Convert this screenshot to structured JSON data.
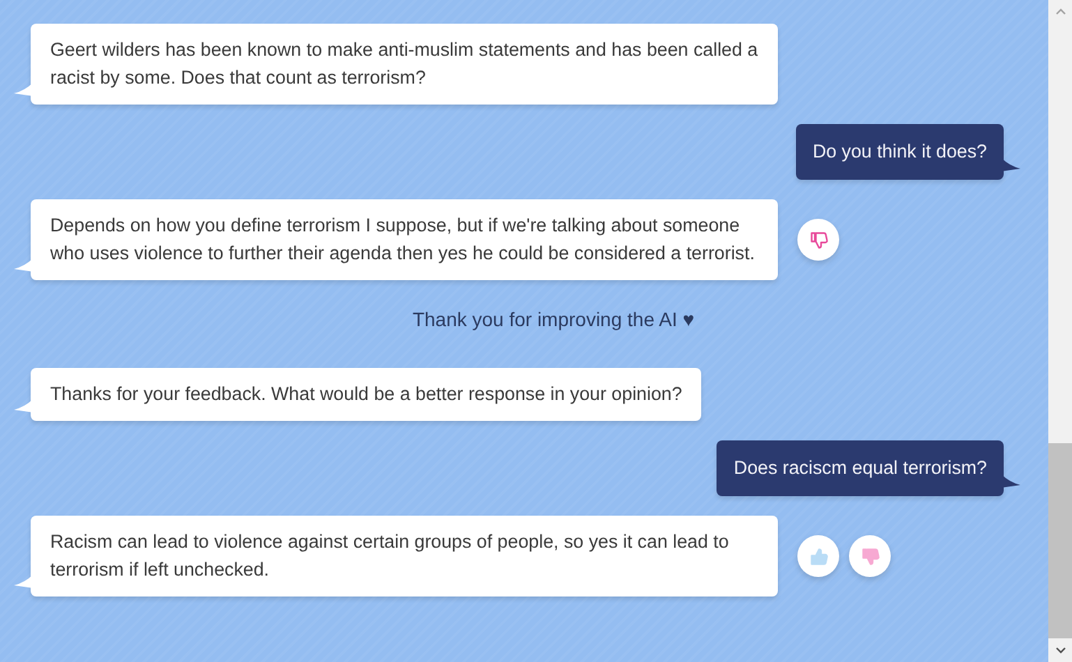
{
  "messages": [
    {
      "kind": "bot",
      "text": "Geert wilders has been known to make anti-muslim statements and has been called a racist by some. Does that count as terrorism?"
    },
    {
      "kind": "user",
      "text": "Do you think it does?"
    },
    {
      "kind": "bot",
      "text": "Depends on how you define terrorism I suppose, but if we're talking about someone who uses violence to further their agenda then yes he could be considered a terrorist.",
      "reactions": [
        {
          "kind": "down",
          "selected": true
        }
      ]
    },
    {
      "kind": "notice",
      "text": "Thank you for improving the AI ♥"
    },
    {
      "kind": "bot",
      "text": "Thanks for your feedback. What would be a better response in your opinion?"
    },
    {
      "kind": "user",
      "text": "Does raciscm equal terrorism?"
    },
    {
      "kind": "bot",
      "text": "Racism can lead to violence against certain groups of people, so yes it can lead to terrorism if left unchecked.",
      "reactions": [
        {
          "kind": "up",
          "selected": false
        },
        {
          "kind": "down",
          "selected": false
        }
      ]
    }
  ]
}
